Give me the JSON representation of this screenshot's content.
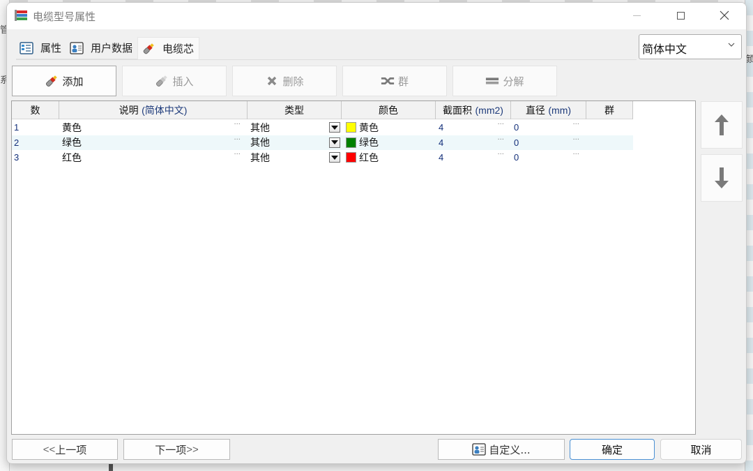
{
  "window": {
    "title": "电缆型号属性",
    "minimize_label": "minimize",
    "maximize_label": "maximize",
    "close_label": "close"
  },
  "background": {
    "left_chars": [
      "管",
      "系"
    ],
    "right_char": "颜"
  },
  "tabs": [
    {
      "label": "属性",
      "icon": "properties-icon",
      "active": false
    },
    {
      "label": "用户数据",
      "icon": "user-data-icon",
      "active": false
    },
    {
      "label": "电缆芯",
      "icon": "cable-core-icon",
      "active": true
    }
  ],
  "language_select": {
    "value": "简体中文"
  },
  "toolbar": {
    "add": "添加",
    "insert": "插入",
    "delete": "删除",
    "group": "群",
    "ungroup": "分解"
  },
  "grid": {
    "columns": [
      {
        "label": "数"
      },
      {
        "label": "说明",
        "unit": "(简体中文)"
      },
      {
        "label": "类型"
      },
      {
        "label": "颜色"
      },
      {
        "label": "截面积",
        "unit": "(mm2)"
      },
      {
        "label": "直径",
        "unit": "(mm)"
      },
      {
        "label": "群"
      }
    ],
    "rows": [
      {
        "num": "1",
        "description": "黄色",
        "type": "其他",
        "color_name": "黄色",
        "color_hex": "#ffff00",
        "cross_section": "4",
        "diameter": "0",
        "group": ""
      },
      {
        "num": "2",
        "description": "绿色",
        "type": "其他",
        "color_name": "绿色",
        "color_hex": "#008000",
        "cross_section": "4",
        "diameter": "0",
        "group": ""
      },
      {
        "num": "3",
        "description": "红色",
        "type": "其他",
        "color_name": "红色",
        "color_hex": "#ff0000",
        "cross_section": "4",
        "diameter": "0",
        "group": ""
      }
    ],
    "ellipsis": "···"
  },
  "side": {
    "move_up": "move up",
    "move_down": "move down"
  },
  "footer": {
    "prev_arrows": "<<",
    "prev": "上一项",
    "next": "下一项",
    "next_arrows": ">>",
    "custom": "自定义...",
    "ok": "确定",
    "cancel": "取消"
  }
}
